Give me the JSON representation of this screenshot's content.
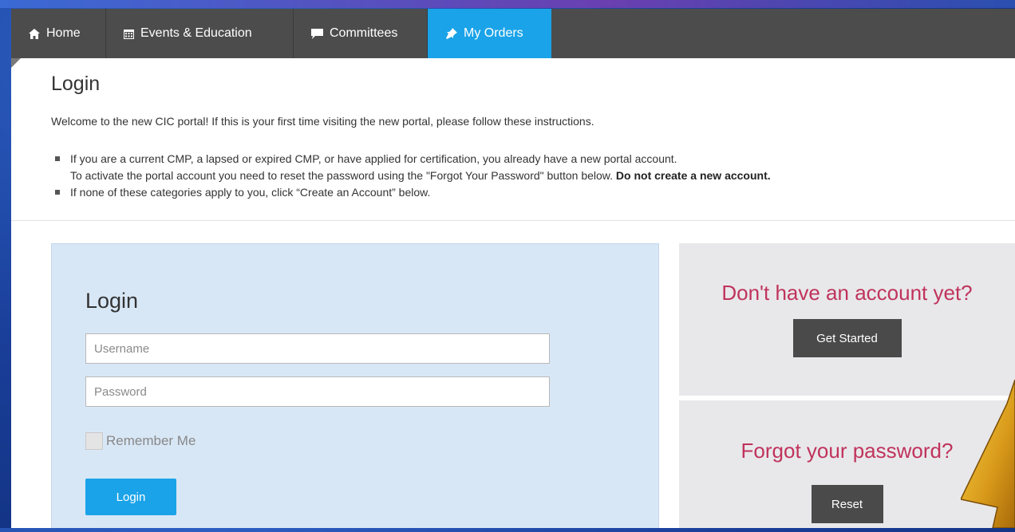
{
  "nav": {
    "items": [
      {
        "label": "Home",
        "icon": "home-icon",
        "active": false
      },
      {
        "label": "Events & Education",
        "icon": "calendar-icon",
        "active": false
      },
      {
        "label": "Committees",
        "icon": "speech-bubble-icon",
        "active": false
      },
      {
        "label": "My Orders",
        "icon": "pushpin-icon",
        "active": true
      }
    ]
  },
  "page": {
    "title": "Login",
    "welcome": "Welcome to the new CIC portal! If this is your first time visiting the new portal, please follow these instructions.",
    "instructions": [
      {
        "line1": "If you are a current CMP, a lapsed or expired CMP, or have applied for certification, you already have a new portal account.",
        "line2": "To activate the portal account you need to reset the password using the \"Forgot Your Password\" button below.",
        "line2_bold": "Do not create a new account."
      },
      {
        "line1": "If none of these categories apply to you, click “Create an Account” below."
      }
    ]
  },
  "login_form": {
    "heading": "Login",
    "username_placeholder": "Username",
    "username_value": "",
    "password_placeholder": "Password",
    "password_value": "",
    "remember_label": "Remember Me",
    "remember_checked": false,
    "submit_label": "Login"
  },
  "signup_box": {
    "heading": "Don't have an account yet?",
    "button_label": "Get Started"
  },
  "reset_box": {
    "heading": "Forgot your password?",
    "button_label": "Reset"
  },
  "colors": {
    "nav_bg": "#4c4c4c",
    "accent": "#1aa3e8",
    "headline_pink": "#c0335c",
    "login_panel_bg": "#d8e7f6",
    "side_box_bg": "#e8e8ea",
    "arrow_gold": "#d99a1a"
  }
}
